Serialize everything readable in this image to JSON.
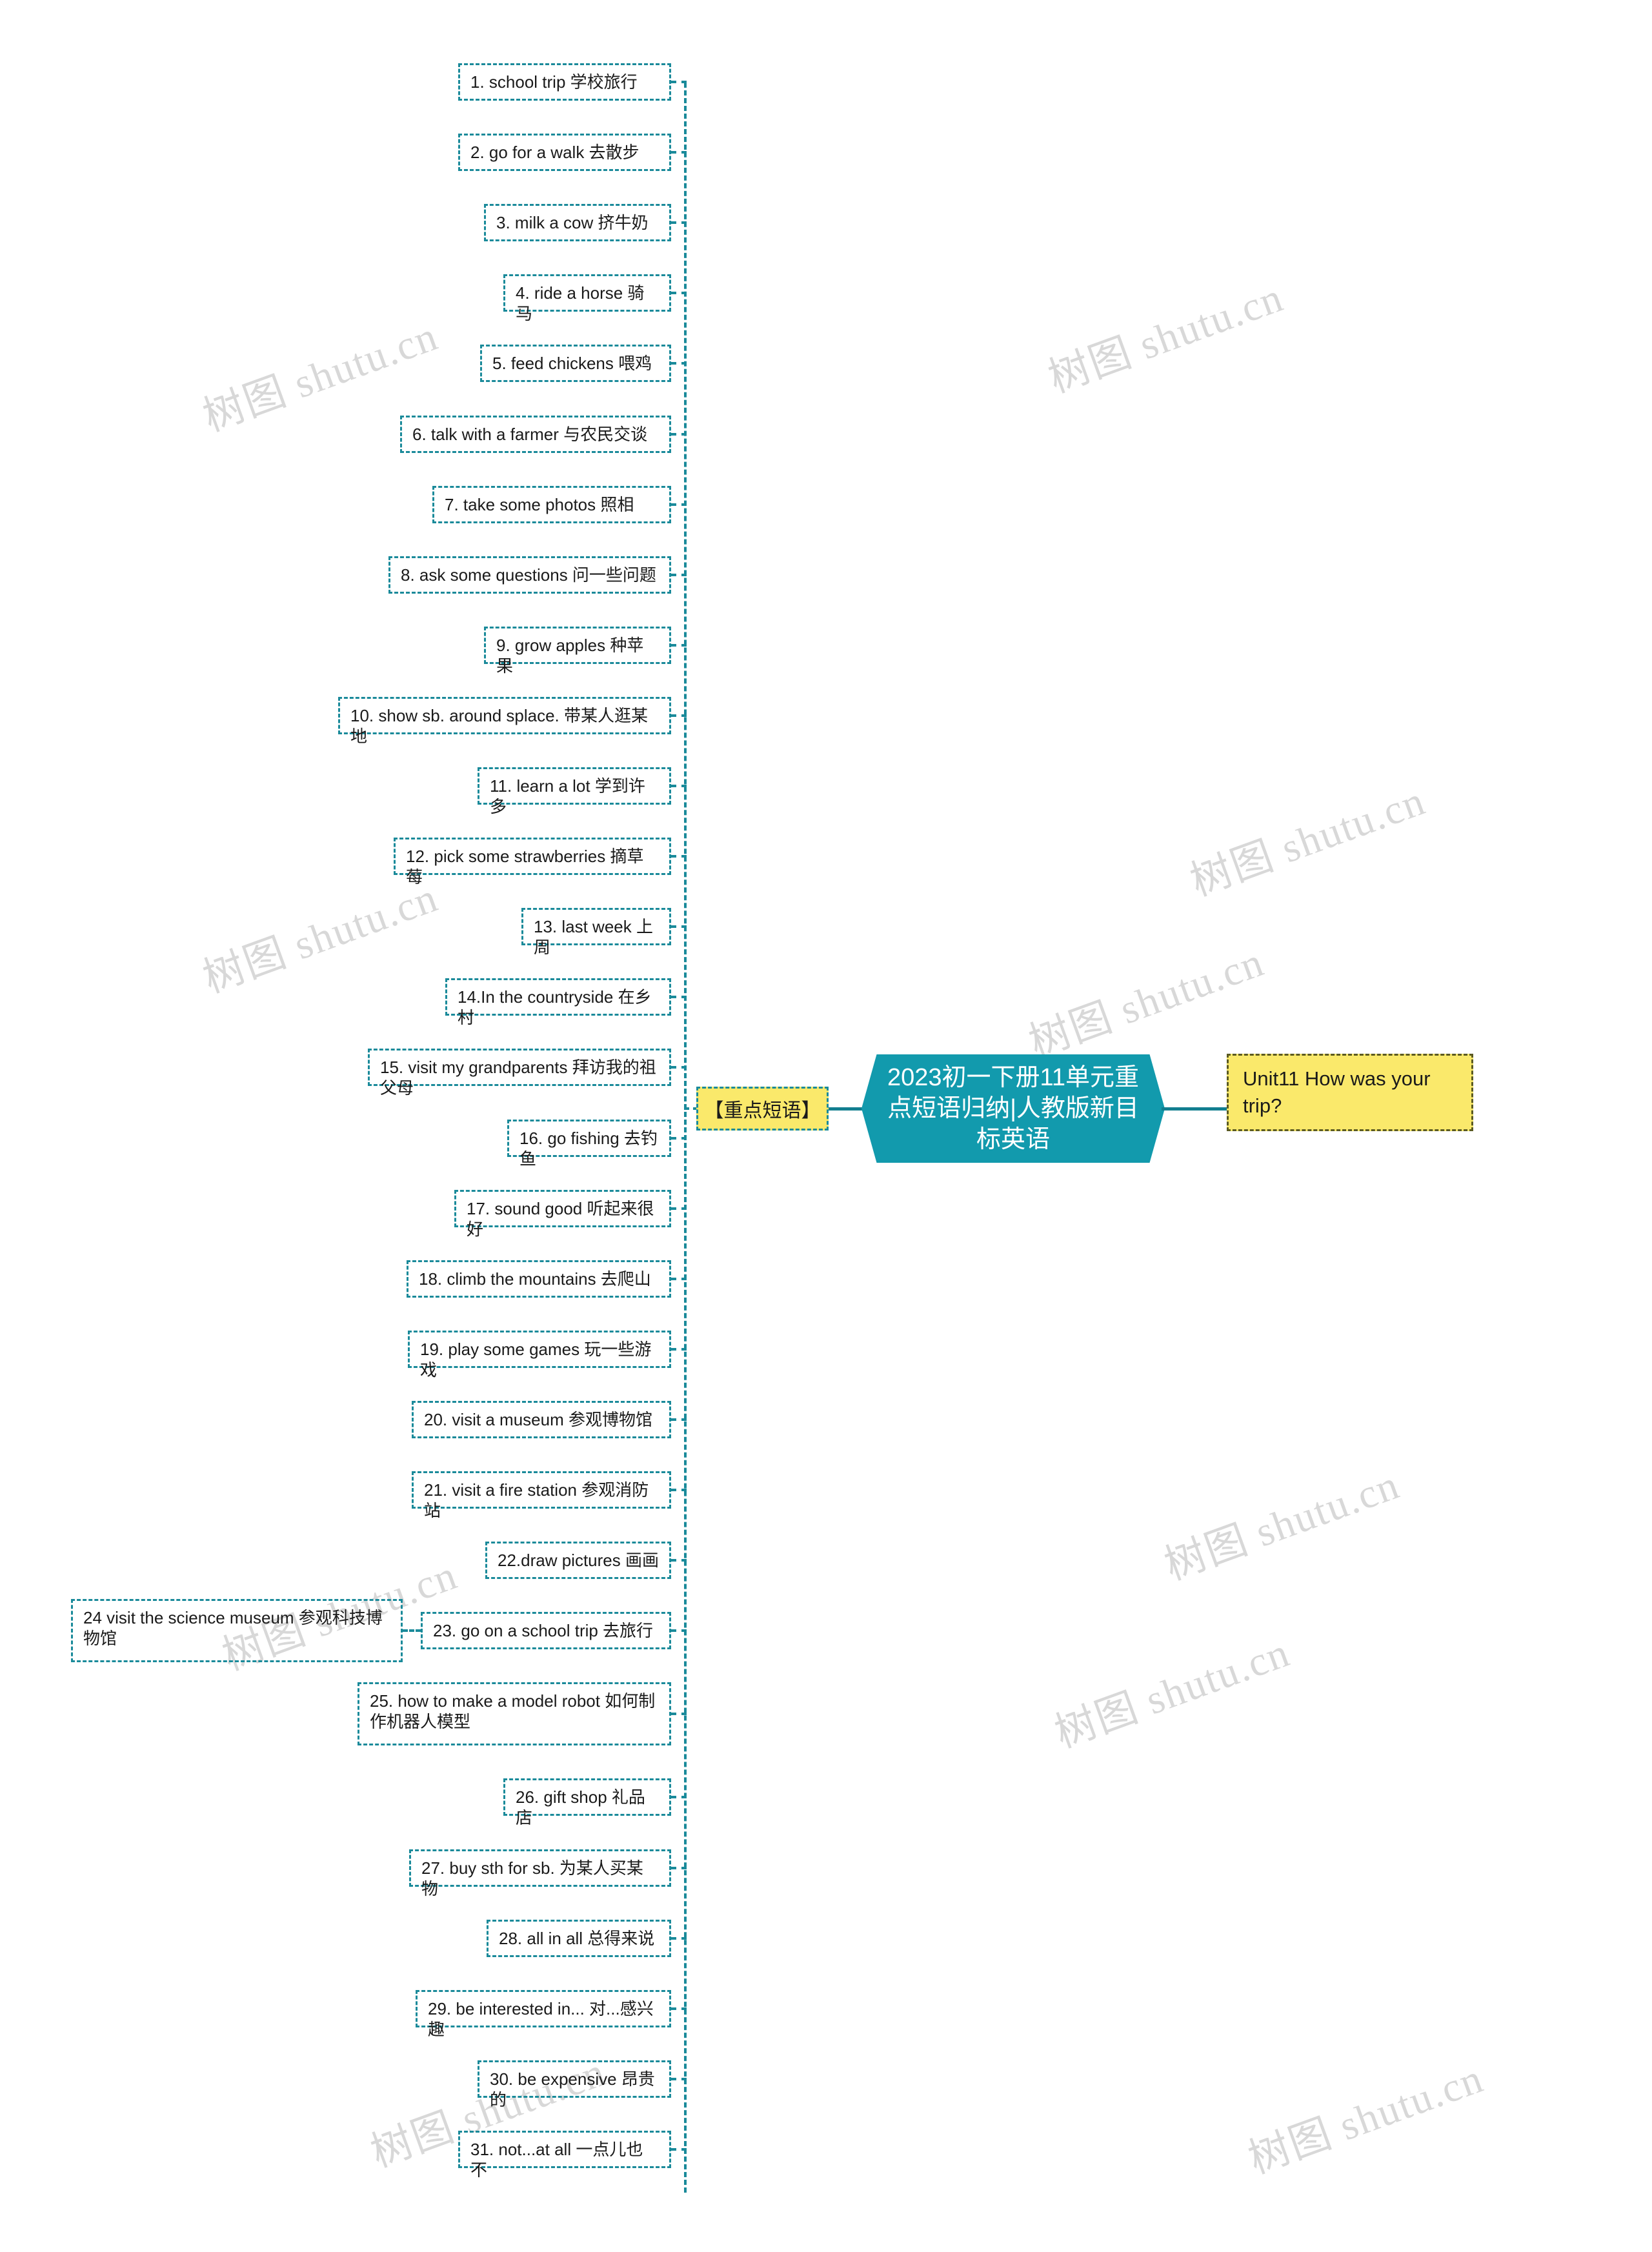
{
  "mindmap": {
    "center": {
      "title": "2023初一下册11单元重点短语归纳|人教版新目标英语",
      "color": "#129aad"
    },
    "left_node": {
      "label": "【重点短语】",
      "bg": "#fae96b",
      "border": "#1a8a9a"
    },
    "right_node": {
      "label": "Unit11 How was your trip?",
      "bg": "#fae96b",
      "border": "#5b5a22"
    },
    "phrases": [
      {
        "n": 1,
        "text": "1. school trip 学校旅行"
      },
      {
        "n": 2,
        "text": "2. go for a walk 去散步"
      },
      {
        "n": 3,
        "text": "3. milk a cow 挤牛奶"
      },
      {
        "n": 4,
        "text": "4. ride a horse 骑马"
      },
      {
        "n": 5,
        "text": "5. feed chickens 喂鸡"
      },
      {
        "n": 6,
        "text": "6. talk with a farmer 与农民交谈"
      },
      {
        "n": 7,
        "text": "7. take some photos 照相"
      },
      {
        "n": 8,
        "text": "8. ask some questions 问一些问题"
      },
      {
        "n": 9,
        "text": "9. grow apples 种苹果"
      },
      {
        "n": 10,
        "text": "10. show sb. around splace. 带某人逛某地"
      },
      {
        "n": 11,
        "text": "11. learn a lot 学到许多"
      },
      {
        "n": 12,
        "text": "12. pick some strawberries 摘草莓"
      },
      {
        "n": 13,
        "text": "13. last week 上周"
      },
      {
        "n": 14,
        "text": "14.In the countryside 在乡村"
      },
      {
        "n": 15,
        "text": "15. visit my grandparents 拜访我的祖父母"
      },
      {
        "n": 16,
        "text": "16. go fishing 去钓鱼"
      },
      {
        "n": 17,
        "text": "17. sound good 听起来很好"
      },
      {
        "n": 18,
        "text": "18. climb the mountains 去爬山"
      },
      {
        "n": 19,
        "text": "19. play some games 玩一些游戏"
      },
      {
        "n": 20,
        "text": "20. visit a museum 参观博物馆"
      },
      {
        "n": 21,
        "text": "21. visit a fire station 参观消防站"
      },
      {
        "n": 22,
        "text": "22.draw pictures 画画"
      },
      {
        "n": 23,
        "text": "23. go on a school trip 去旅行"
      },
      {
        "n": 25,
        "text": "25. how to make a model robot 如何制作机器人模型"
      },
      {
        "n": 26,
        "text": "26. gift shop 礼品店"
      },
      {
        "n": 27,
        "text": "27. buy sth for sb. 为某人买某物"
      },
      {
        "n": 28,
        "text": "28. all in all 总得来说"
      },
      {
        "n": 29,
        "text": "29. be interested in... 对...感兴趣"
      },
      {
        "n": 30,
        "text": "30. be expensive 昂贵的"
      },
      {
        "n": 31,
        "text": "31. not...at all 一点儿也不"
      }
    ],
    "sub_phrase": {
      "n": 24,
      "text": "24 visit the science museum 参观科技博物馆",
      "parent": 23
    },
    "watermark": {
      "text": "树图 shutu.cn",
      "color": "#d8d8d8"
    }
  }
}
